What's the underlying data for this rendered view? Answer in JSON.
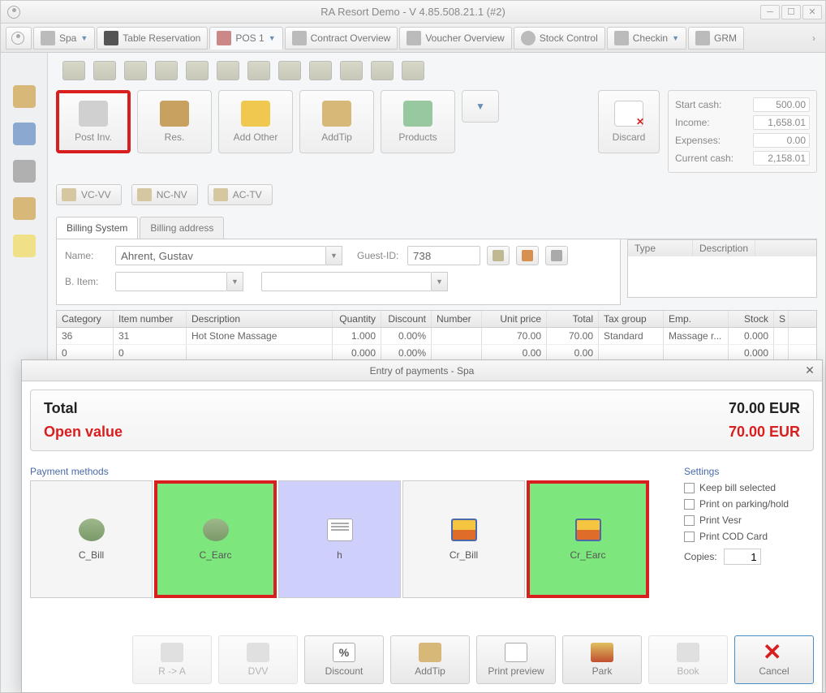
{
  "window": {
    "title": "RA Resort Demo - V 4.85.508.21.1 (#2)"
  },
  "tabs": [
    {
      "label": "Spa"
    },
    {
      "label": "Table Reservation"
    },
    {
      "label": "POS 1",
      "active": true
    },
    {
      "label": "Contract Overview"
    },
    {
      "label": "Voucher Overview"
    },
    {
      "label": "Stock Control"
    },
    {
      "label": "Checkin"
    },
    {
      "label": "GRM"
    }
  ],
  "actions": {
    "post_inv": "Post Inv.",
    "res": "Res.",
    "add_other": "Add Other",
    "add_tip": "AddTip",
    "products": "Products",
    "discard": "Discard"
  },
  "cash": {
    "start_label": "Start cash:",
    "start_val": "500.00",
    "income_label": "Income:",
    "income_val": "1,658.01",
    "expenses_label": "Expenses:",
    "expenses_val": "0.00",
    "current_label": "Current cash:",
    "current_val": "2,158.01"
  },
  "filters": {
    "a": "VC-VV",
    "b": "NC-NV",
    "c": "AC-TV"
  },
  "inner_tabs": {
    "billing_system": "Billing System",
    "billing_address": "Billing address"
  },
  "form": {
    "name_label": "Name:",
    "name_value": "Ahrent, Gustav",
    "guest_id_label": "Guest-ID:",
    "guest_id_value": "738",
    "bitem_label": "B. Item:"
  },
  "side_grid": {
    "type": "Type",
    "desc": "Description"
  },
  "grid": {
    "headers": {
      "cat": "Category",
      "item": "Item number",
      "desc": "Description",
      "qty": "Quantity",
      "disc": "Discount",
      "num": "Number",
      "up": "Unit price",
      "tot": "Total",
      "tax": "Tax group",
      "emp": "Emp.",
      "stk": "Stock",
      "s": "S"
    },
    "rows": [
      {
        "cat": "36",
        "item": "31",
        "desc": "Hot Stone Massage",
        "qty": "1.000",
        "disc": "0.00%",
        "num": "",
        "up": "70.00",
        "tot": "70.00",
        "tax": "Standard",
        "emp": "Massage r...",
        "stk": "0.000",
        "s": ""
      },
      {
        "cat": "0",
        "item": "0",
        "desc": "",
        "qty": "0.000",
        "disc": "0.00%",
        "num": "",
        "up": "0.00",
        "tot": "0.00",
        "tax": "",
        "emp": "",
        "stk": "0.000",
        "s": ""
      }
    ]
  },
  "modal": {
    "title": "Entry of payments - Spa",
    "total_label": "Total",
    "total_value": "70.00 EUR",
    "open_label": "Open value",
    "open_value": "70.00 EUR",
    "pm_label": "Payment methods",
    "settings_label": "Settings",
    "methods": {
      "c_bill": "C_Bill",
      "c_earc": "C_Earc",
      "h": "h",
      "cr_bill": "Cr_Bill",
      "cr_earc": "Cr_Earc"
    },
    "settings": {
      "keep_bill": "Keep bill selected",
      "print_park": "Print on parking/hold",
      "print_vesr": "Print Vesr",
      "print_cod": "Print COD Card",
      "copies_label": "Copies:",
      "copies_value": "1"
    },
    "bottom": {
      "ra": "R -> A",
      "dvv": "DVV",
      "discount": "Discount",
      "addtip": "AddTip",
      "preview": "Print preview",
      "park": "Park",
      "book": "Book",
      "cancel": "Cancel"
    }
  }
}
